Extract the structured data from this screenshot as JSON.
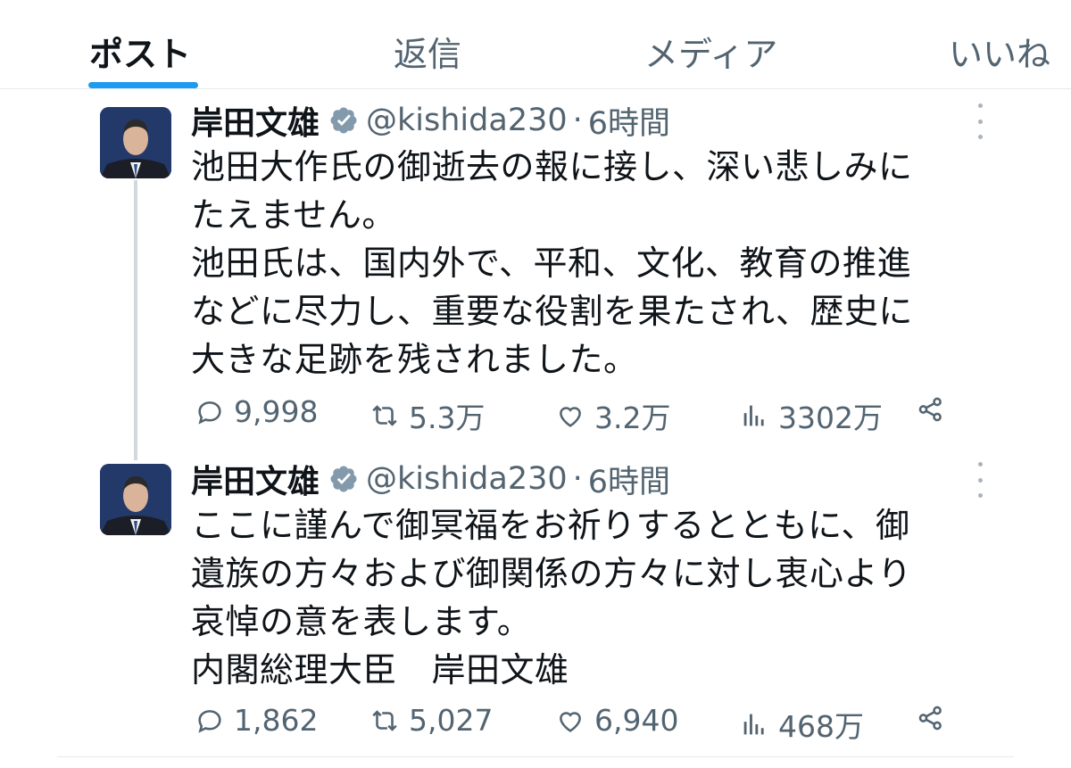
{
  "tabs": [
    {
      "label": "ポスト",
      "active": true
    },
    {
      "label": "返信",
      "active": false
    },
    {
      "label": "メディア",
      "active": false
    },
    {
      "label": "いいね",
      "active": false
    }
  ],
  "tweets": [
    {
      "author_name": "岸田文雄",
      "handle": "@kishida230",
      "separator": "·",
      "time": "6時間",
      "lines": [
        "池田大作氏の御逝去の報に接し、深い悲しみに",
        "たえません。",
        "池田氏は、国内外で、平和、文化、教育の推進",
        "などに尽力し、重要な役割を果たされ、歴史に",
        "大きな足跡を残されました。"
      ],
      "stats": {
        "replies": "9,998",
        "reposts": "5.3万",
        "likes": "3.2万",
        "views": "3302万"
      }
    },
    {
      "author_name": "岸田文雄",
      "handle": "@kishida230",
      "separator": "·",
      "time": "6時間",
      "lines": [
        "ここに謹んで御冥福をお祈りするとともに、御",
        "遺族の方々および御関係の方々に対し衷心より",
        "哀悼の意を表します。",
        "内閣総理大臣　岸田文雄"
      ],
      "stats": {
        "replies": "1,862",
        "reposts": "5,027",
        "likes": "6,940",
        "views": "468万"
      }
    }
  ],
  "icons": {
    "verified": "verified-badge-icon",
    "more": "more-options-icon",
    "reply": "reply-icon",
    "repost": "repost-icon",
    "like": "like-icon",
    "views": "views-icon",
    "share": "share-icon"
  },
  "colors": {
    "accent": "#1d9bf0",
    "text": "#0f1419",
    "secondary": "#536471",
    "verified": "#829aab",
    "divider": "#e6e9ec"
  }
}
